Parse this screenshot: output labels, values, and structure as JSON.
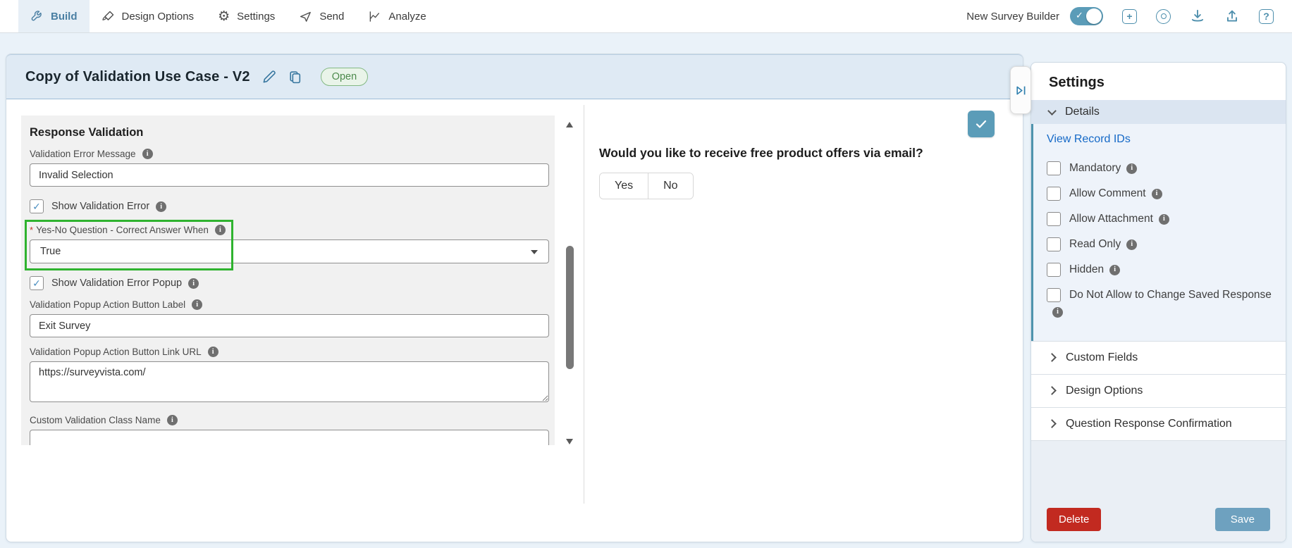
{
  "toolbar": {
    "tabs": [
      {
        "label": "Build",
        "active": true
      },
      {
        "label": "Design Options",
        "active": false
      },
      {
        "label": "Settings",
        "active": false
      },
      {
        "label": "Send",
        "active": false
      },
      {
        "label": "Analyze",
        "active": false
      }
    ],
    "toggle": {
      "label": "New Survey Builder",
      "state": "on"
    },
    "icons": [
      "add-icon",
      "preview-icon",
      "download-icon",
      "upload-icon",
      "help-icon"
    ]
  },
  "survey_header": {
    "title": "Copy of Validation Use Case - V2",
    "status_badge": "Open"
  },
  "validation_form": {
    "heading": "Response Validation",
    "error_message": {
      "label": "Validation Error Message",
      "value": "Invalid Selection"
    },
    "show_validation_error": {
      "label": "Show Validation Error",
      "checked": true
    },
    "correct_answer_when": {
      "label": "Yes-No Question - Correct Answer When",
      "required_marker": "*",
      "value": "True",
      "highlighted": true
    },
    "show_validation_error_popup": {
      "label": "Show Validation Error Popup",
      "checked": true
    },
    "popup_action_button_label": {
      "label": "Validation Popup Action Button Label",
      "value": "Exit Survey"
    },
    "popup_action_button_url": {
      "label": "Validation Popup Action Button Link URL",
      "value": "https://surveyvista.com/"
    },
    "custom_class_name": {
      "label": "Custom Validation Class Name",
      "value": ""
    }
  },
  "question_preview": {
    "title": "Would you like to receive free product offers via email?",
    "options": [
      {
        "label": "Yes"
      },
      {
        "label": "No"
      }
    ]
  },
  "settings_panel": {
    "title": "Settings",
    "details_section": {
      "label": "Details",
      "record_ids_link": "View Record IDs",
      "checkboxes": [
        {
          "label": "Mandatory",
          "checked": false
        },
        {
          "label": "Allow Comment",
          "checked": false
        },
        {
          "label": "Allow Attachment",
          "checked": false
        },
        {
          "label": "Read Only",
          "checked": false
        },
        {
          "label": "Hidden",
          "checked": false
        },
        {
          "label": "Do Not Allow to Change Saved Response",
          "checked": false
        }
      ]
    },
    "accordions": [
      {
        "label": "Custom Fields"
      },
      {
        "label": "Design Options"
      },
      {
        "label": "Question Response Confirmation"
      }
    ],
    "buttons": {
      "delete": "Delete",
      "save": "Save"
    }
  },
  "colors": {
    "accent_teal": "#5b9cb8",
    "icon_blue": "#4e8fad",
    "link_blue": "#1569c7",
    "highlight_green": "#2fb32f",
    "badge_green": "#4c8a4c",
    "delete_red": "#c22a20",
    "save_blue": "#6ea1bf",
    "details_header_bg": "#dbe5f1",
    "details_body_bg": "#eef3fa"
  }
}
